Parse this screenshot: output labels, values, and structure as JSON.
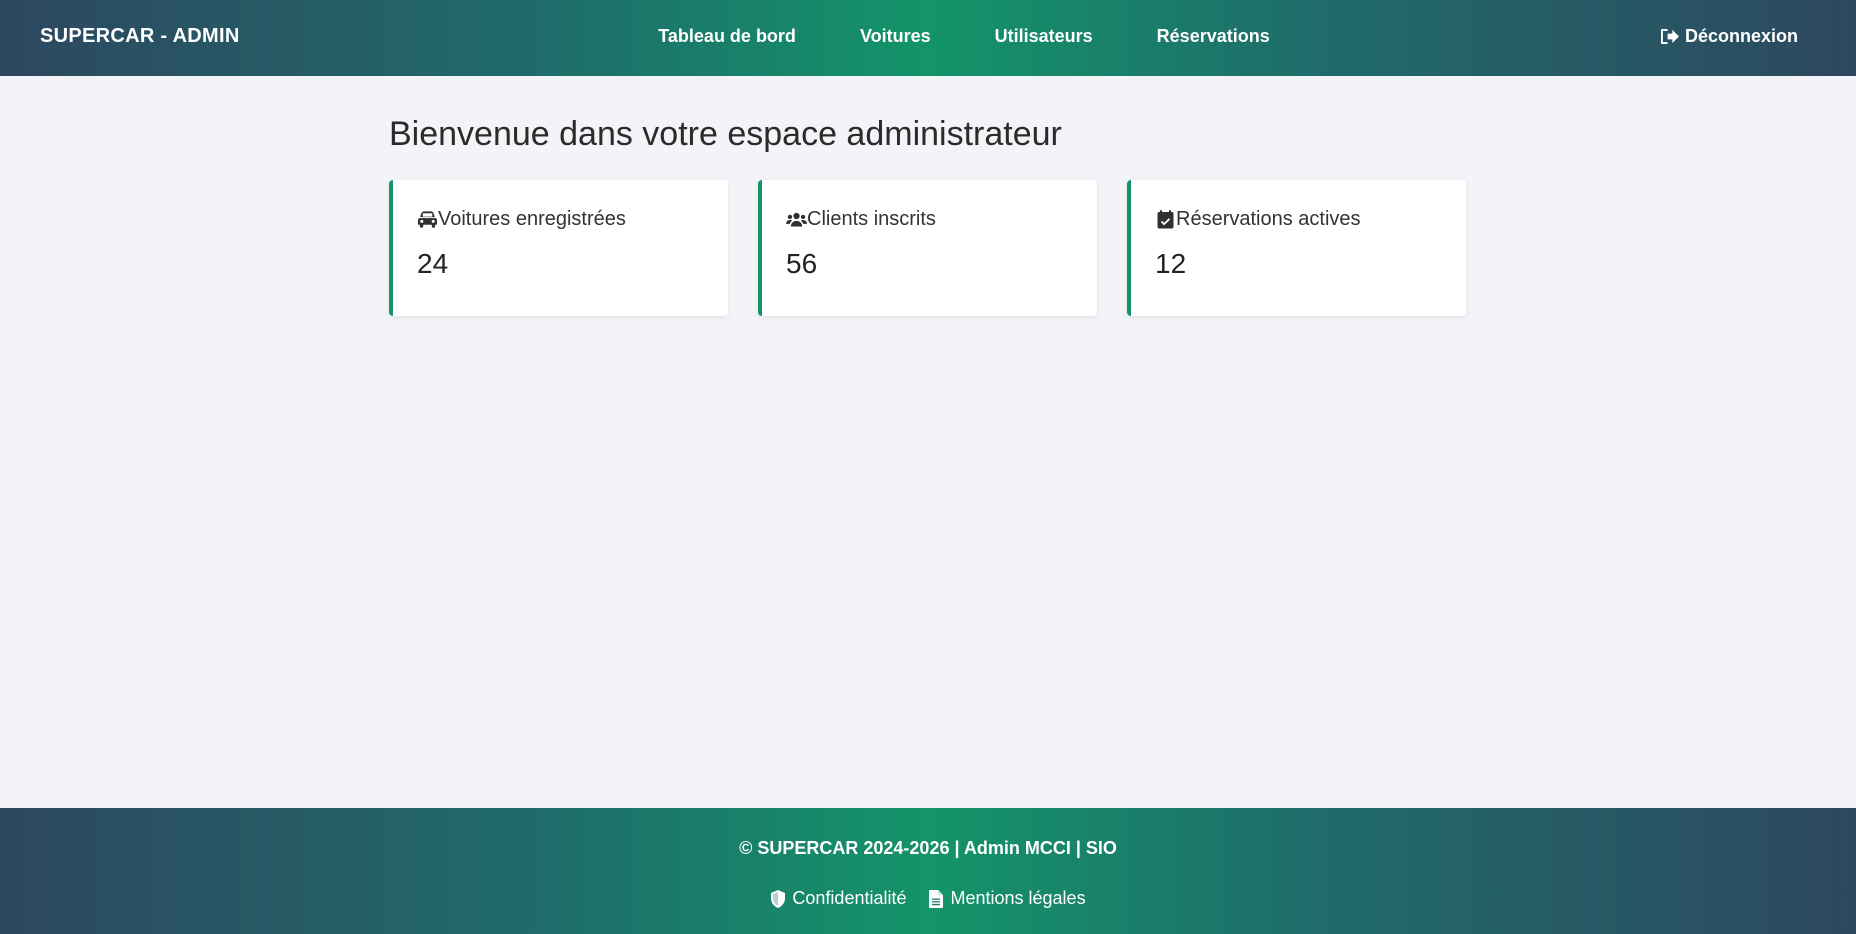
{
  "navbar": {
    "brand": "SUPERCAR - ADMIN",
    "links": [
      "Tableau de bord",
      "Voitures",
      "Utilisateurs",
      "Réservations"
    ],
    "logout_label": "Déconnexion",
    "logout_icon": "sign-out-icon"
  },
  "main": {
    "title": "Bienvenue dans votre espace administrateur",
    "cards": [
      {
        "icon": "car-icon",
        "label": "Voitures enregistrées",
        "value": "24"
      },
      {
        "icon": "users-icon",
        "label": "Clients inscrits",
        "value": "56"
      },
      {
        "icon": "calendar-check-icon",
        "label": "Réservations actives",
        "value": "12"
      }
    ]
  },
  "footer": {
    "copyright": "© SUPERCAR 2024-2026 | Admin MCCI | SIO",
    "links": [
      {
        "icon": "shield-icon",
        "label": "Confidentialité"
      },
      {
        "icon": "file-icon",
        "label": "Mentions légales"
      }
    ]
  },
  "colors": {
    "accent": "#14946b",
    "header_dark": "#2d4760",
    "background": "#f3f4f8"
  }
}
